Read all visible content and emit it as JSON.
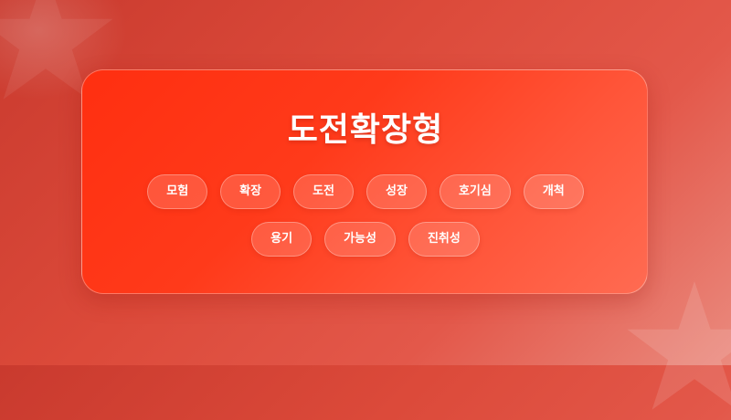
{
  "title": "도전확장형",
  "tags_row1": [
    "모험",
    "확장",
    "도전",
    "성장",
    "호기심",
    "개척"
  ],
  "tags_row2": [
    "용기",
    "가능성",
    "진취성"
  ],
  "colors": {
    "background": "#dc4a3a",
    "card": "#ff3a1a",
    "text": "#ffffff"
  },
  "icons": [
    "star-shape",
    "star-shape"
  ]
}
